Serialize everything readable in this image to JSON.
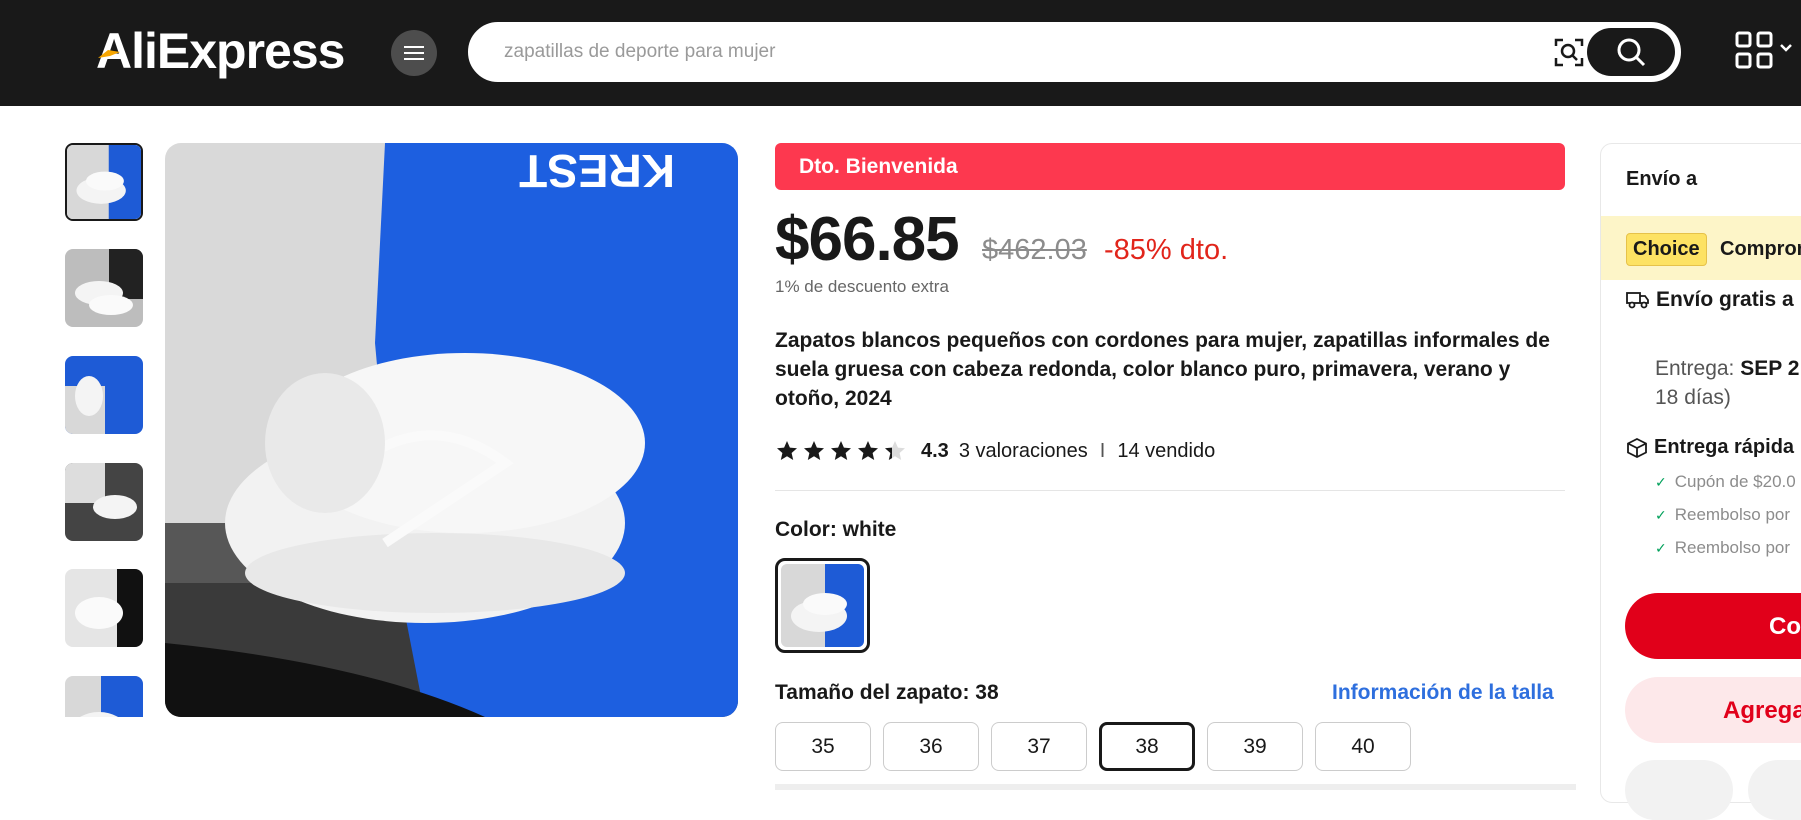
{
  "header": {
    "logo_text": "AliExpress",
    "search_placeholder": "zapatillas de deporte para mujer",
    "icons": [
      "menu-icon",
      "camera-search-icon",
      "search-icon",
      "qr-code-icon",
      "chevron-down-icon"
    ]
  },
  "gallery": {
    "thumbnail_count": 6,
    "active_index": 0
  },
  "product": {
    "promo_banner": "Dto. Bienvenida",
    "price": "$66.85",
    "original_price": "$462.03",
    "discount": "-85% dto.",
    "extra_discount": "1% de descuento extra",
    "title": "Zapatos blancos pequeños con cordones para mujer, zapatillas informales de suela gruesa con cabeza redonda, color blanco puro, primavera, verano y otoño, 2024",
    "rating": "4.3",
    "rating_stars": 4.3,
    "reviews": "3 valoraciones",
    "rating_separator": "I",
    "sold": "14 vendido",
    "color_label": "Color: white",
    "size_label": "Tamaño del zapato: 38",
    "size_info_link": "Información de la talla",
    "sizes": [
      "35",
      "36",
      "37",
      "38",
      "39",
      "40"
    ],
    "selected_size": "38"
  },
  "shipping": {
    "ship_to": "Envío a",
    "choice_badge": "Choice",
    "choice_text": "Compror",
    "free_shipping": "Envío gratis a",
    "delivery_prefix": "Entrega: ",
    "delivery_date": "SEP 2",
    "delivery_days": "18 días)",
    "fast_delivery": "Entrega rápida",
    "benefits": [
      "Cupón de $20.0",
      "Reembolso por",
      "Reembolso por"
    ],
    "buy_button": "Co",
    "cart_button": "Agrega"
  },
  "colors": {
    "header_bg": "#191919",
    "promo_red": "#fd384f",
    "discount_red": "#e1251b",
    "link_blue": "#2e6fde",
    "choice_yellow": "#fde263",
    "buy_red": "#e1001a"
  }
}
